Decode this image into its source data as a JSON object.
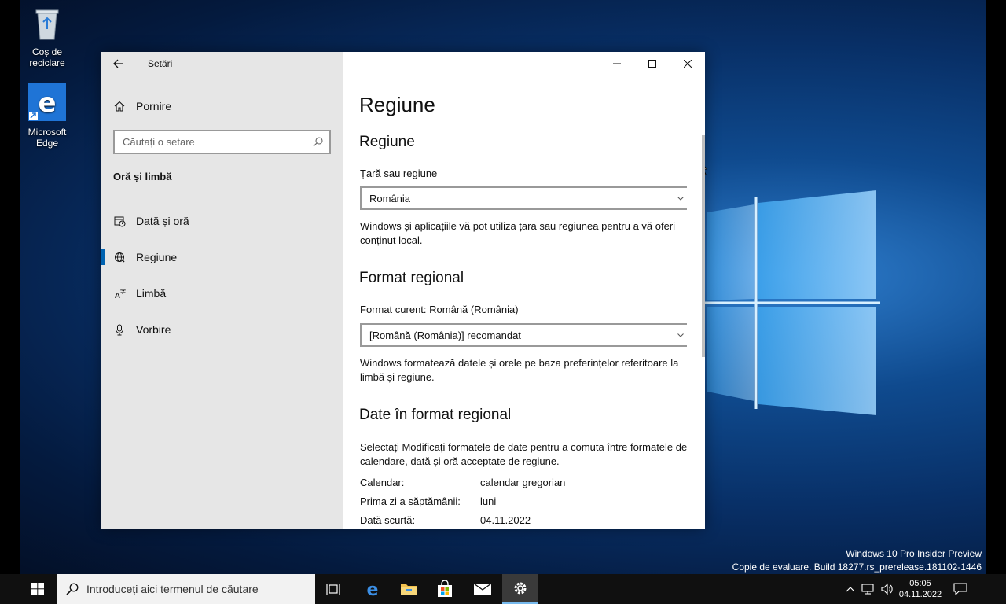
{
  "desktop": {
    "icons": [
      {
        "label": "Coș de reciclare",
        "icon": "recycle-bin-icon"
      },
      {
        "label": "Microsoft Edge",
        "icon": "edge-icon"
      }
    ],
    "watermark": {
      "line1": "Windows 10 Pro Insider Preview",
      "line2": "Copie de evaluare. Build 18277.rs_prerelease.181102-1446"
    }
  },
  "window": {
    "app_title": "Setări",
    "nav": {
      "home_label": "Pornire",
      "search_placeholder": "Căutați o setare",
      "section_title": "Oră și limbă",
      "items": [
        {
          "label": "Dată și oră",
          "icon": "calendar-clock-icon"
        },
        {
          "label": "Regiune",
          "icon": "globe-icon",
          "selected": true
        },
        {
          "label": "Limbă",
          "icon": "language-icon"
        },
        {
          "label": "Vorbire",
          "icon": "microphone-icon"
        }
      ]
    },
    "content": {
      "page_title": "Regiune",
      "region": {
        "heading": "Regiune",
        "country_label": "Țară sau regiune",
        "country_value": "România",
        "description": "Windows și aplicațiile vă pot utiliza țara sau regiunea pentru a vă oferi conținut local."
      },
      "format": {
        "heading": "Format regional",
        "current_label": "Format curent: Română (România)",
        "format_value": "[Română (România)] recomandat",
        "description": "Windows formatează datele și orele pe baza preferințelor referitoare la limbă și regiune."
      },
      "data_format": {
        "heading": "Date în format regional",
        "description": "Selectați Modificați formatele de date pentru a comuta între formatele de calendare, dată și oră acceptate de regiune.",
        "rows": [
          {
            "key": "Calendar:",
            "value": "calendar gregorian"
          },
          {
            "key": "Prima zi a săptămânii:",
            "value": "luni"
          },
          {
            "key": "Dată scurtă:",
            "value": "04.11.2022"
          }
        ]
      }
    }
  },
  "taskbar": {
    "search_placeholder": "Introduceți aici termenul de căutare",
    "pinned": [
      "task-view-icon",
      "edge-icon",
      "file-explorer-icon",
      "store-icon",
      "mail-icon",
      "settings-icon"
    ],
    "clock_time": "05:05",
    "clock_date": "04.11.2022"
  },
  "colors": {
    "accent": "#0063b1",
    "nav_bg": "#e6e6e6",
    "taskbar_bg": "#101010"
  }
}
